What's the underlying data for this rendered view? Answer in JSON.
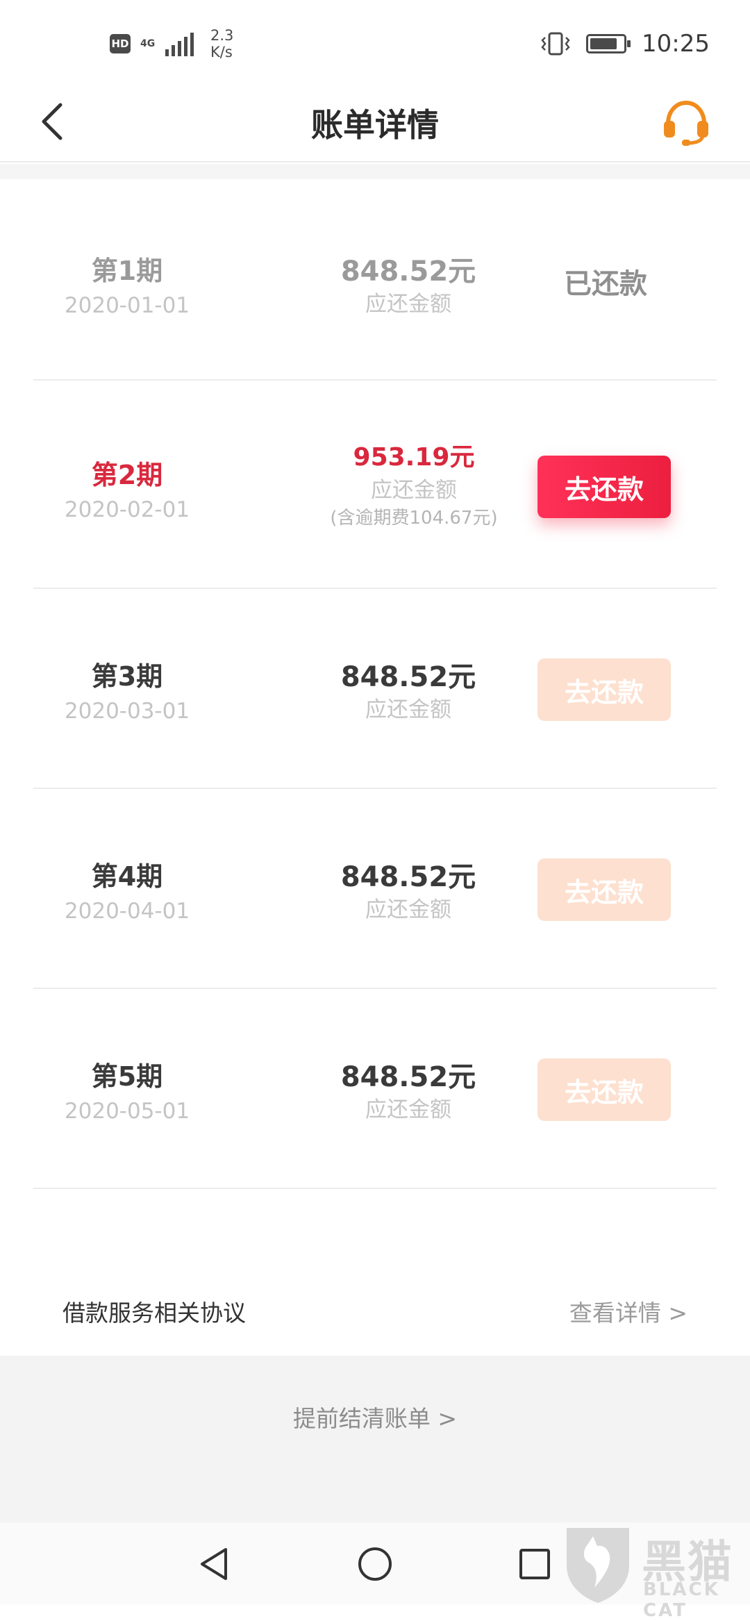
{
  "status_bar": {
    "hd": "HD",
    "network": "4G",
    "speed_value": "2.3",
    "speed_unit": "K/s",
    "time": "10:25",
    "icons": [
      "vibrate-icon",
      "battery-icon"
    ]
  },
  "header": {
    "title": "账单详情",
    "icons": [
      "back-arrow-icon",
      "customer-service-headset-icon"
    ],
    "accent_color": "#f08c1e"
  },
  "periods": [
    {
      "name": "第1期",
      "date": "2020-01-01",
      "amount": "848.52元",
      "amount_label": "应还金额",
      "status": "已还款"
    },
    {
      "name": "第2期",
      "date": "2020-02-01",
      "amount": "953.19元",
      "amount_label": "应还金额",
      "note": "(含逾期费104.67元)",
      "button": "去还款"
    },
    {
      "name": "第3期",
      "date": "2020-03-01",
      "amount": "848.52元",
      "amount_label": "应还金额",
      "button": "去还款"
    },
    {
      "name": "第4期",
      "date": "2020-04-01",
      "amount": "848.52元",
      "amount_label": "应还金额",
      "button": "去还款"
    },
    {
      "name": "第5期",
      "date": "2020-05-01",
      "amount": "848.52元",
      "amount_label": "应还金额",
      "button": "去还款"
    }
  ],
  "colors": {
    "overdue_red": "#d9283d",
    "active_button": "#f2284a",
    "disabled_button": "#fde0cf"
  },
  "agreement": {
    "label": "借款服务相关协议",
    "link": "查看详情 >"
  },
  "settle": {
    "label": "提前结清账单 >"
  },
  "nav_bar": {
    "icons": [
      "nav-back-icon",
      "nav-home-icon",
      "nav-recents-icon"
    ]
  },
  "watermark": {
    "text": "黑猫",
    "sub": "BLACK CAT"
  }
}
